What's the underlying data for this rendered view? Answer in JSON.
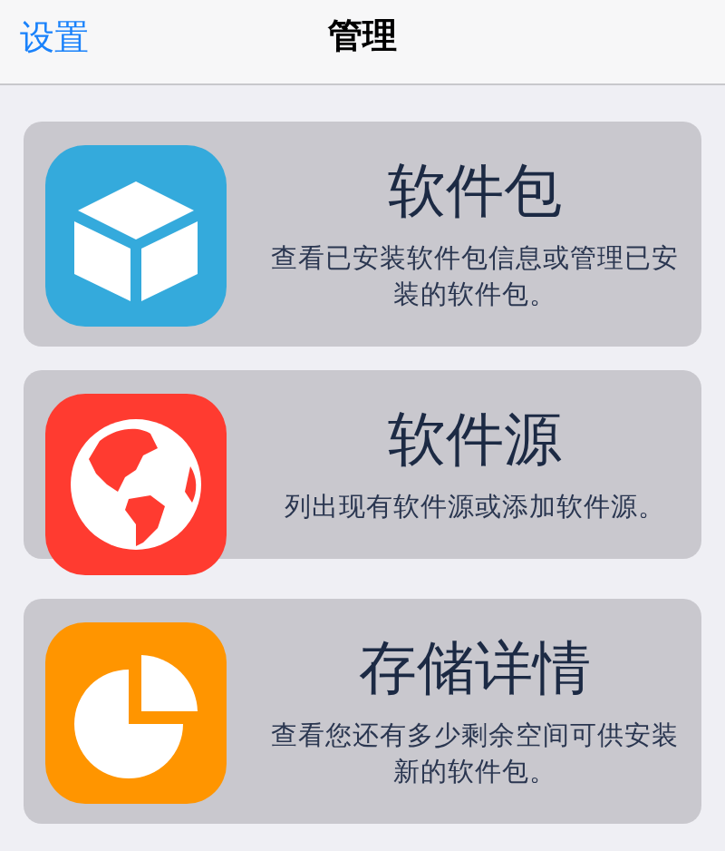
{
  "nav_bar": {
    "back": "设置",
    "title": "管理"
  },
  "items": [
    {
      "kind": "box",
      "title": "软件包",
      "description": "查看已安装软件包信息或管理已安装的软件包。"
    },
    {
      "kind": "globe",
      "title": "软件源",
      "description": "列出现有软件源或添加软件源。"
    },
    {
      "kind": "pie",
      "title": "存储详情",
      "description": "查看您还有多少剩余空间可供安装新的软件包。"
    }
  ]
}
